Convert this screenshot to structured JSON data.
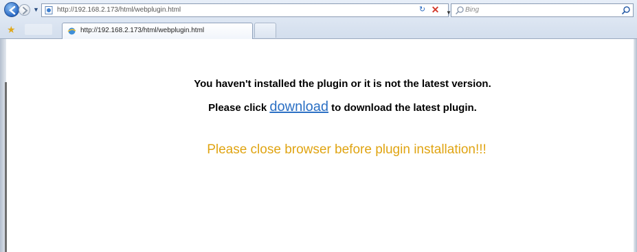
{
  "browser": {
    "address_url": "http://192.168.2.173/html/webplugin.html",
    "search_placeholder": "Bing",
    "tab_label": "http://192.168.2.173/html/webplugin.html",
    "colors": {
      "chrome_top": "#e7eef8",
      "chrome_bottom": "#d3deed",
      "back_button": "#2a69c4",
      "stop_button": "#d43a2c"
    },
    "icons": [
      "back-arrow-icon",
      "forward-arrow-icon",
      "page-icon",
      "refresh-icon",
      "stop-icon",
      "search-icon",
      "favorites-star-icon",
      "ie-tab-icon"
    ]
  },
  "page": {
    "message_line1": "You haven't installed the plugin or it is not the latest version.",
    "message_line2_prefix": "Please click ",
    "download_link_text": "download",
    "message_line2_suffix": " to download the latest plugin.",
    "warning_text": "Please close browser before plugin installation!!!",
    "colors": {
      "link": "#2a6fc4",
      "warning": "#e0a412",
      "text": "#000000"
    }
  }
}
